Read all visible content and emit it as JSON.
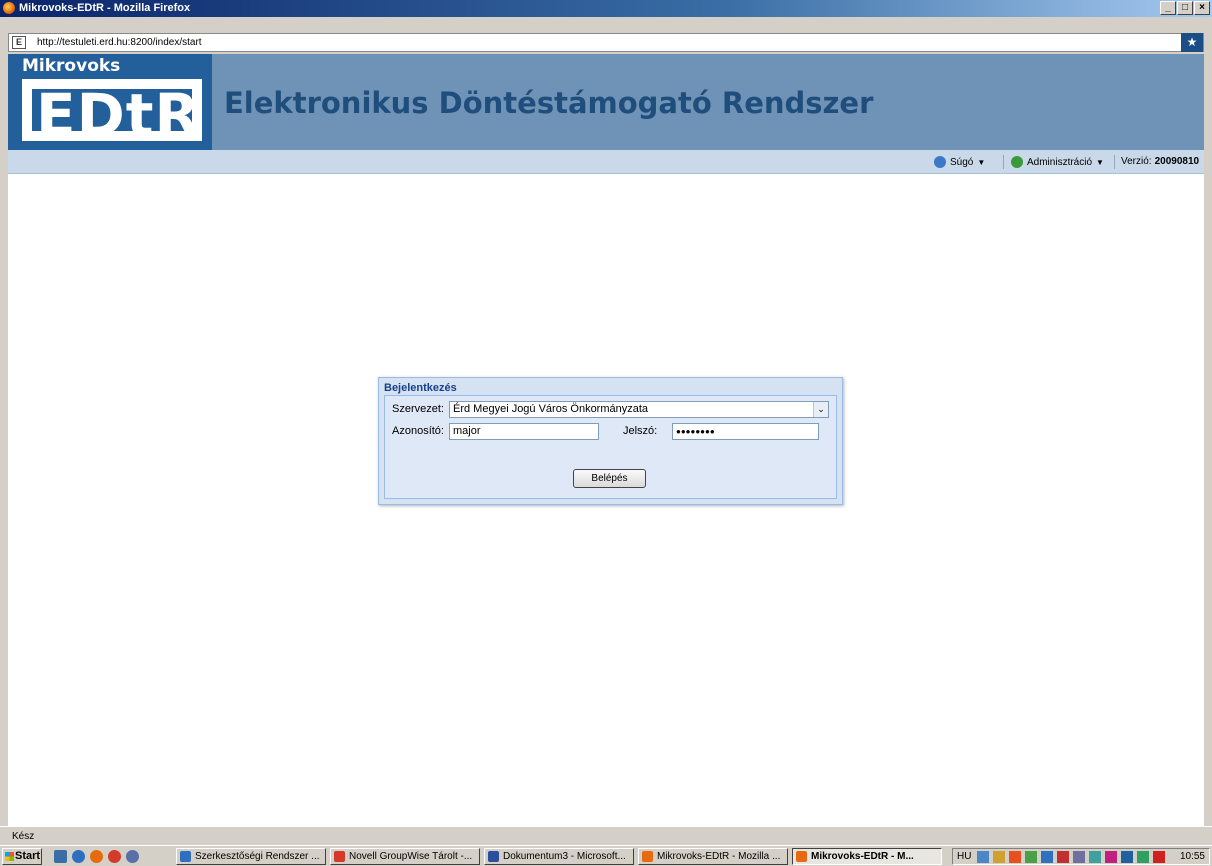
{
  "window": {
    "title": "Mikrovoks-EDtR - Mozilla Firefox",
    "buttons": [
      "_",
      "□",
      "×"
    ]
  },
  "address_bar": {
    "url": "http://testuleti.erd.hu:8200/index/start",
    "page_icon": "E",
    "bookmark_icon": "★"
  },
  "header": {
    "brand_small": "Mikrovoks",
    "brand_logo": "EDtR",
    "title": "Elektronikus Döntéstámogató Rendszer"
  },
  "toolbar": {
    "help_label": "Súgó",
    "admin_label": "Adminisztráció",
    "version_prefix": "Verzió:",
    "version_value": "20090810",
    "dropdown_arrow": "▼",
    "help_icon_color": "#3b78c6",
    "admin_icon_color": "#3a9a3a"
  },
  "login": {
    "panel_title": "Bejelentkezés",
    "org_label": "Szervezet:",
    "org_value": "Érd Megyei Jogú Város Önkormányzata",
    "org_arrow": "⌄",
    "user_label": "Azonosító:",
    "user_value": "major",
    "password_label": "Jelszó:",
    "password_value": "●●●●●●●●",
    "submit_label": "Belépés"
  },
  "status_bar": {
    "status": "Kész"
  },
  "taskbar": {
    "start_label": "Start",
    "tasks": [
      {
        "label": "Szerkesztőségi Rendszer ...",
        "icon_color": "#2f6fc2"
      },
      {
        "label": "Novell GroupWise Tárolt -...",
        "icon_color": "#d43a2a"
      },
      {
        "label": "Dokumentum3 - Microsoft...",
        "icon_color": "#2a4f9c"
      },
      {
        "label": "Mikrovoks-EDtR - Mozilla ...",
        "icon_color": "#e86a10"
      },
      {
        "label": "Mikrovoks-EDtR - M...",
        "icon_color": "#e86a10"
      }
    ],
    "language": "HU",
    "clock": "10:55"
  }
}
